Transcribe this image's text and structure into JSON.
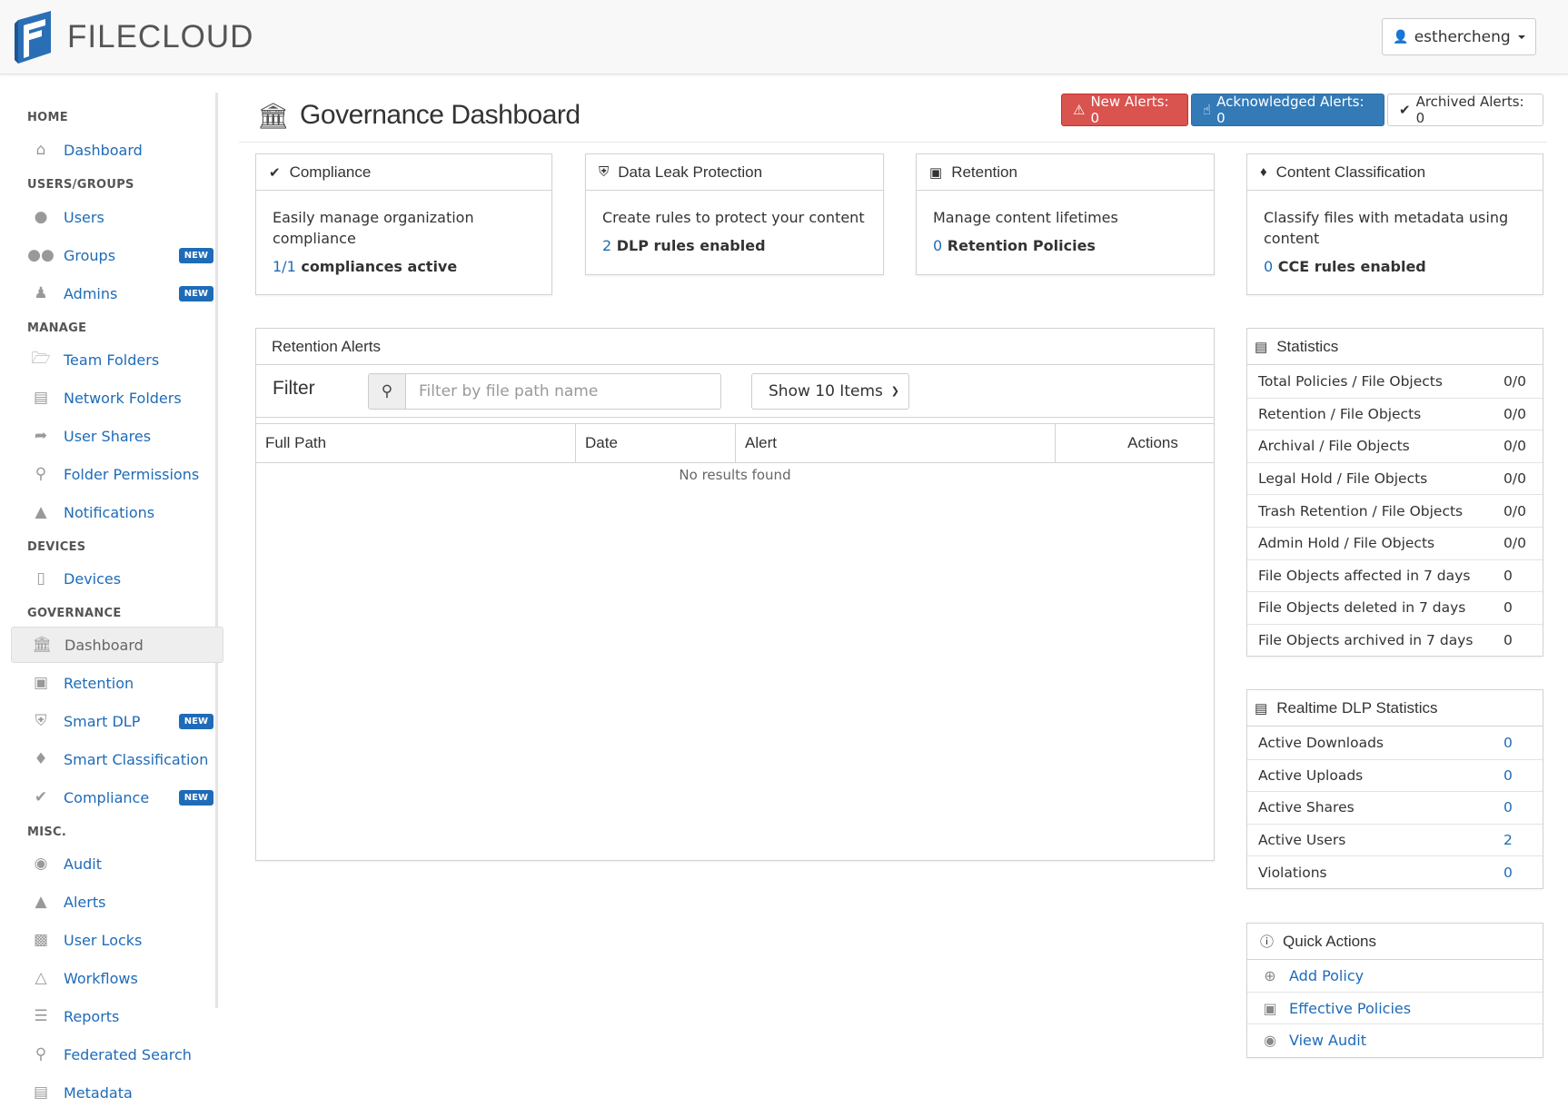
{
  "header": {
    "logo_text": "FILECLOUD",
    "user": "esthercheng"
  },
  "sidebar": {
    "sections": {
      "home": "HOME",
      "users_groups": "USERS/GROUPS",
      "manage": "MANAGE",
      "devices": "DEVICES",
      "governance": "GOVERNANCE",
      "misc": "MISC."
    },
    "badge_new": "NEW",
    "items": {
      "dashboard": "Dashboard",
      "users": "Users",
      "groups": "Groups",
      "admins": "Admins",
      "team_folders": "Team Folders",
      "network_folders": "Network Folders",
      "user_shares": "User Shares",
      "folder_permissions": "Folder Permissions",
      "notifications": "Notifications",
      "devices": "Devices",
      "gov_dashboard": "Dashboard",
      "retention": "Retention",
      "smart_dlp": "Smart DLP",
      "smart_classification": "Smart Classification",
      "compliance": "Compliance",
      "audit": "Audit",
      "alerts": "Alerts",
      "user_locks": "User Locks",
      "workflows": "Workflows",
      "reports": "Reports",
      "federated_search": "Federated Search",
      "metadata": "Metadata"
    }
  },
  "page": {
    "title": "Governance Dashboard",
    "alerts": {
      "new": "New Alerts: 0",
      "acknowledged": "Acknowledged Alerts: 0",
      "archived": "Archived Alerts: 0"
    }
  },
  "cards": {
    "compliance": {
      "title": "Compliance",
      "desc": "Easily manage organization compliance",
      "num": "1/1",
      "stat": "compliances active"
    },
    "dlp": {
      "title": "Data Leak Protection",
      "desc": "Create rules to protect your content",
      "num": "2",
      "stat": "DLP rules enabled"
    },
    "retention": {
      "title": "Retention",
      "desc": "Manage content lifetimes",
      "num": "0",
      "stat": "Retention Policies"
    },
    "classification": {
      "title": "Content Classification",
      "desc": "Classify files with metadata using content",
      "num": "0",
      "stat": "CCE rules enabled"
    }
  },
  "retention_alerts": {
    "title": "Retention Alerts",
    "filter_label": "Filter",
    "filter_placeholder": "Filter by file path name",
    "show_select": "Show 10 Items",
    "columns": [
      "Full Path",
      "Date",
      "Alert",
      "Actions"
    ],
    "empty": "No results found"
  },
  "statistics": {
    "title": "Statistics",
    "rows": [
      {
        "label": "Total Policies / File Objects",
        "value": "0/0"
      },
      {
        "label": "Retention / File Objects",
        "value": "0/0"
      },
      {
        "label": "Archival / File Objects",
        "value": "0/0"
      },
      {
        "label": "Legal Hold / File Objects",
        "value": "0/0"
      },
      {
        "label": "Trash Retention / File Objects",
        "value": "0/0"
      },
      {
        "label": "Admin Hold / File Objects",
        "value": "0/0"
      },
      {
        "label": "File Objects affected in 7 days",
        "value": "0"
      },
      {
        "label": "File Objects deleted in 7 days",
        "value": "0"
      },
      {
        "label": "File Objects archived in 7 days",
        "value": "0"
      }
    ]
  },
  "dlp_stats": {
    "title": "Realtime DLP Statistics",
    "rows": [
      {
        "label": "Active Downloads",
        "value": "0"
      },
      {
        "label": "Active Uploads",
        "value": "0"
      },
      {
        "label": "Active Shares",
        "value": "0"
      },
      {
        "label": "Active Users",
        "value": "2"
      },
      {
        "label": "Violations",
        "value": "0"
      }
    ]
  },
  "quick_actions": {
    "title": "Quick Actions",
    "add_policy": "Add Policy",
    "effective_policies": "Effective Policies",
    "view_audit": "View Audit"
  },
  "colors": {
    "link": "#1e6bb8",
    "danger": "#d9534f",
    "primary": "#337ab7",
    "badge": "#1e6bb8"
  }
}
